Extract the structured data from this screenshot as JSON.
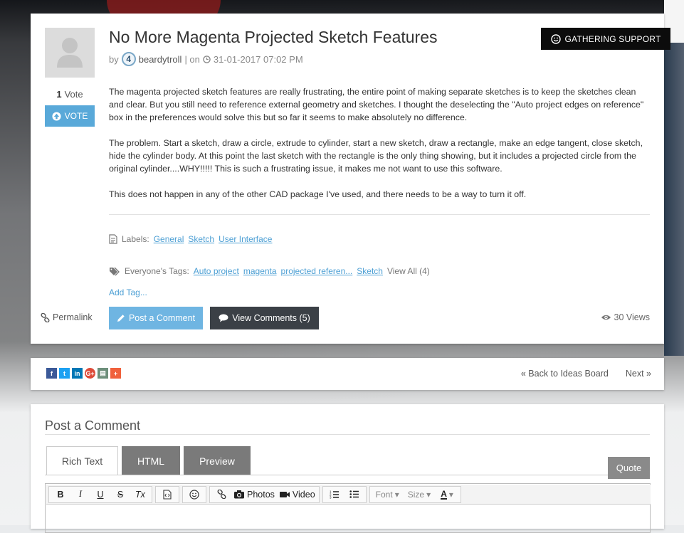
{
  "idea": {
    "title": "No More Magenta Projected Sketch Features",
    "by_label": "by",
    "author_rank": "4",
    "author": "beardytroll",
    "on_label": "| on",
    "date": "31-01-2017 07:02 PM",
    "status": "GATHERING SUPPORT",
    "vote_count": "1",
    "vote_label": "Vote",
    "vote_button": "VOTE",
    "body": [
      "The magenta projected sketch features are really frustrating, the entire point of making separate sketches is to keep the sketches clean and clear. But you still need to reference external geometry and sketches. I thought the deselecting the \"Auto project edges on reference\" box in the preferences would solve this but so far it seems to make absolutely no difference.",
      "The problem. Start a sketch, draw a circle, extrude to cylinder, start a new sketch, draw a rectangle, make an edge tangent, close sketch, hide the cylinder body. At this point the last sketch with the rectangle is the only thing showing, but it includes a projected circle from the original cylinder....WHY!!!!! This is such a frustrating issue, it makes me not want to use this software.",
      "This does not happen in any of the other CAD package I've used, and there needs to be a way to turn it off."
    ],
    "labels_title": "Labels:",
    "labels": [
      "General",
      "Sketch",
      "User Interface"
    ],
    "tags_title": "Everyone's Tags:",
    "tags": [
      "Auto project",
      "magenta",
      "projected referen...",
      "Sketch"
    ],
    "view_all": "View All (4)",
    "add_tag": "Add Tag...",
    "permalink": "Permalink",
    "post_comment": "Post a Comment",
    "view_comments": "View Comments (5)",
    "views": "30 Views"
  },
  "share": {
    "icons": [
      "facebook-icon",
      "twitter-icon",
      "linkedin-icon",
      "google-plus-icon",
      "print-icon",
      "more-icon"
    ],
    "back": "« Back to Ideas Board",
    "next": "Next »"
  },
  "comment": {
    "title": "Post a Comment",
    "tabs": [
      "Rich Text",
      "HTML",
      "Preview"
    ],
    "quote": "Quote",
    "toolbar": {
      "bold": "B",
      "italic": "I",
      "underline": "U",
      "strike": "S",
      "clear": "Tx",
      "photos": "Photos",
      "video": "Video",
      "font": "Font",
      "size": "Size",
      "color": "A"
    }
  },
  "colors": {
    "accent": "#59a9d9",
    "status_bg": "#0c0c0c",
    "dark_button": "#3b4046"
  }
}
